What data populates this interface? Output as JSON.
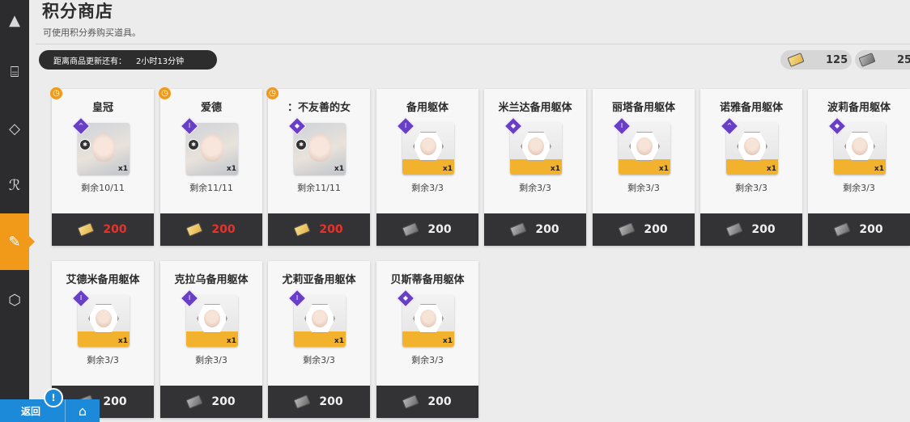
{
  "header": {
    "title": "积分商店",
    "subtitle": "可使用积分券购买道具。",
    "refresh_label": "距离商品更新还有：",
    "refresh_time": "2小时13分钟"
  },
  "currencies": [
    {
      "icon": "gold-ticket-icon",
      "value": "125"
    },
    {
      "icon": "dark-ticket-icon",
      "value": "25"
    }
  ],
  "items": [
    {
      "name": "皇冠",
      "remain": "剩余10/11",
      "price": "200",
      "currency": "gold",
      "kind": "portrait",
      "grade": "^",
      "limited": true
    },
    {
      "name": "爱德",
      "remain": "剩余11/11",
      "price": "200",
      "currency": "gold",
      "kind": "portrait",
      "grade": "I",
      "limited": true
    },
    {
      "name": "：不友善的女",
      "remain": "剩余11/11",
      "price": "200",
      "currency": "gold",
      "kind": "portrait",
      "grade": "◆",
      "limited": true
    },
    {
      "name": "备用躯体",
      "remain": "剩余3/3",
      "price": "200",
      "currency": "dark",
      "kind": "frame",
      "grade": "I",
      "limited": false
    },
    {
      "name": "米兰达备用躯体",
      "remain": "剩余3/3",
      "price": "200",
      "currency": "dark",
      "kind": "frame",
      "grade": "◆",
      "limited": false
    },
    {
      "name": "丽塔备用躯体",
      "remain": "剩余3/3",
      "price": "200",
      "currency": "dark",
      "kind": "frame",
      "grade": "I",
      "limited": false
    },
    {
      "name": "诺雅备用躯体",
      "remain": "剩余3/3",
      "price": "200",
      "currency": "dark",
      "kind": "frame",
      "grade": "^",
      "limited": false
    },
    {
      "name": "波莉备用躯体",
      "remain": "剩余3/3",
      "price": "200",
      "currency": "dark",
      "kind": "frame",
      "grade": "◆",
      "limited": false
    },
    {
      "name": "艾德米备用躯体",
      "remain": "剩余3/3",
      "price": "200",
      "currency": "dark",
      "kind": "frame",
      "grade": "I",
      "limited": false
    },
    {
      "name": "克拉乌备用躯体",
      "remain": "剩余3/3",
      "price": "200",
      "currency": "dark",
      "kind": "frame",
      "grade": "I",
      "limited": false
    },
    {
      "name": "尤莉亚备用躯体",
      "remain": "剩余3/3",
      "price": "200",
      "currency": "dark",
      "kind": "frame",
      "grade": "I",
      "limited": false
    },
    {
      "name": "贝斯蒂备用躯体",
      "remain": "剩余3/3",
      "price": "200",
      "currency": "dark",
      "kind": "frame",
      "grade": "◆",
      "limited": false
    }
  ],
  "qty_label": "x1",
  "bottom": {
    "back_label": "返回",
    "alert": "!"
  }
}
